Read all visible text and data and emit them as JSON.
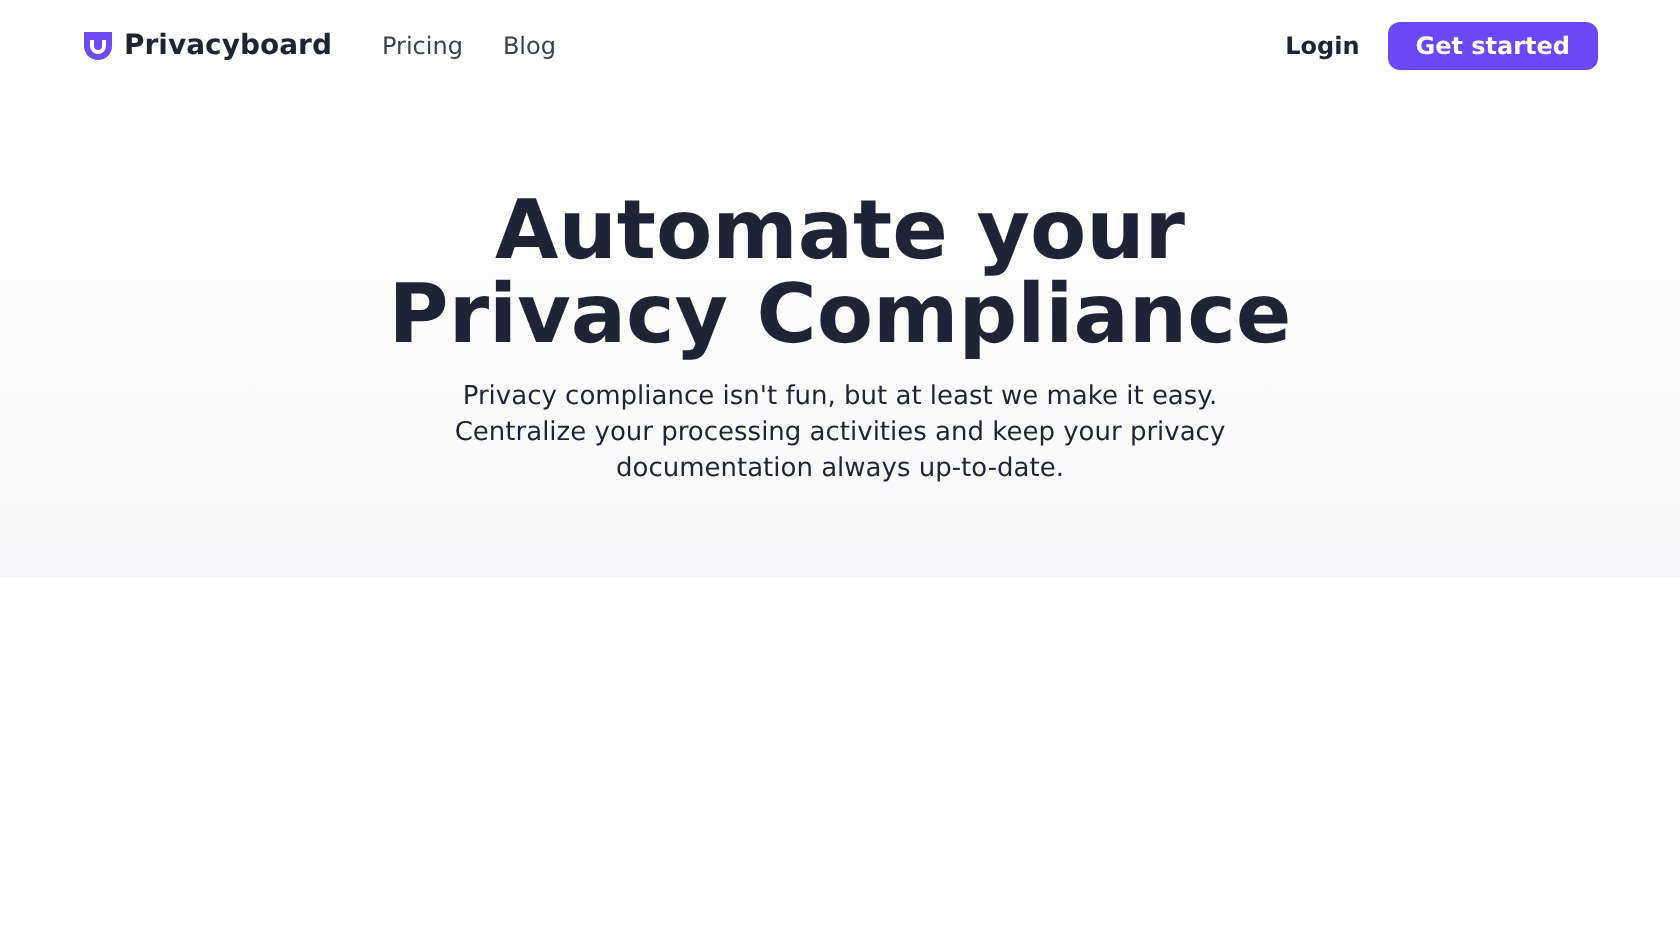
{
  "header": {
    "brand": "Privacyboard",
    "nav": [
      "Pricing",
      "Blog"
    ],
    "login": "Login",
    "cta": "Get started"
  },
  "hero": {
    "title": "Automate your Privacy Compliance",
    "lines": [
      "Privacy compliance isn't fun, but at least we make it easy.",
      "Centralize your processing activities and keep your privacy documentation always up-to-date."
    ]
  }
}
